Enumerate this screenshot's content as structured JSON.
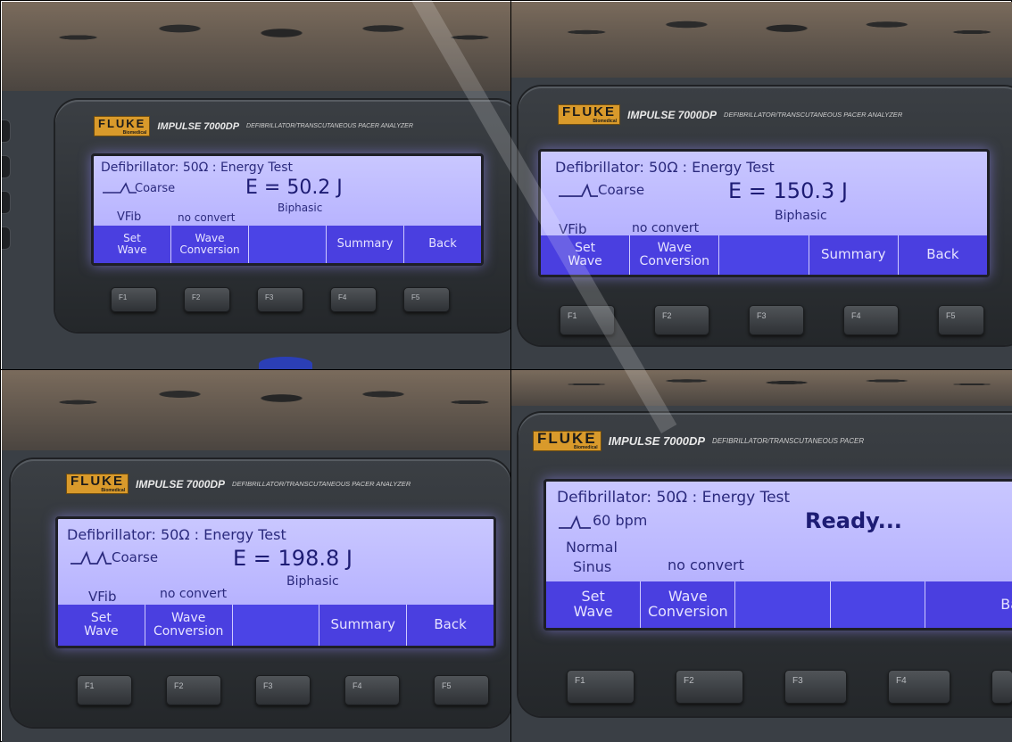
{
  "panels": [
    {
      "brand": {
        "logo": "FLUKE",
        "logo_sub": "Biomedical",
        "model": "IMPULSE 7000DP",
        "desc": "DEFIBRILLATOR/TRANSCUTANEOUS PACER ANALYZER"
      },
      "screen": {
        "header": "Defibrillator:  50Ω : Energy Test",
        "wave_label": "Coarse",
        "energy": "E = 50.2 J",
        "waveform": "Biphasic",
        "wave_type": "VFib",
        "conversion": "no convert",
        "softkeys": [
          "Set\nWave",
          "Wave\nConversion",
          "",
          "Summary",
          "Back"
        ]
      },
      "fkeys": [
        "F1",
        "F2",
        "F3",
        "F4",
        "F5"
      ]
    },
    {
      "brand": {
        "logo": "FLUKE",
        "logo_sub": "Biomedical",
        "model": "IMPULSE 7000DP",
        "desc": "DEFIBRILLATOR/TRANSCUTANEOUS PACER ANALYZER"
      },
      "screen": {
        "header": "Defibrillator:  50Ω : Energy Test",
        "wave_label": "Coarse",
        "energy": "E = 150.3 J",
        "waveform": "Biphasic",
        "wave_type": "VFib",
        "conversion": "no convert",
        "softkeys": [
          "Set\nWave",
          "Wave\nConversion",
          "",
          "Summary",
          "Back"
        ]
      },
      "fkeys": [
        "F1",
        "F2",
        "F3",
        "F4",
        "F5"
      ]
    },
    {
      "brand": {
        "logo": "FLUKE",
        "logo_sub": "Biomedical",
        "model": "IMPULSE 7000DP",
        "desc": "DEFIBRILLATOR/TRANSCUTANEOUS PACER ANALYZER"
      },
      "screen": {
        "header": "Defibrillator:  50Ω : Energy Test",
        "wave_label": "Coarse",
        "energy": "E = 198.8 J",
        "waveform": "Biphasic",
        "wave_type": "VFib",
        "conversion": "no convert",
        "softkeys": [
          "Set\nWave",
          "Wave\nConversion",
          "",
          "Summary",
          "Back"
        ]
      },
      "fkeys": [
        "F1",
        "F2",
        "F3",
        "F4",
        "F5"
      ]
    },
    {
      "brand": {
        "logo": "FLUKE",
        "logo_sub": "Biomedical",
        "model": "IMPULSE 7000DP",
        "desc": "DEFIBRILLATOR/TRANSCUTANEOUS PACER"
      },
      "screen": {
        "header": "Defibrillator:  50Ω : Energy Test",
        "wave_label": "60 bpm",
        "status": "Ready...",
        "wave_type_1": "Normal",
        "wave_type_2": "Sinus",
        "conversion": "no convert",
        "softkeys": [
          "Set\nWave",
          "Wave\nConversion",
          "",
          "",
          "Ba"
        ]
      },
      "fkeys": [
        "F1",
        "F2",
        "F3",
        "F4",
        ""
      ]
    }
  ]
}
